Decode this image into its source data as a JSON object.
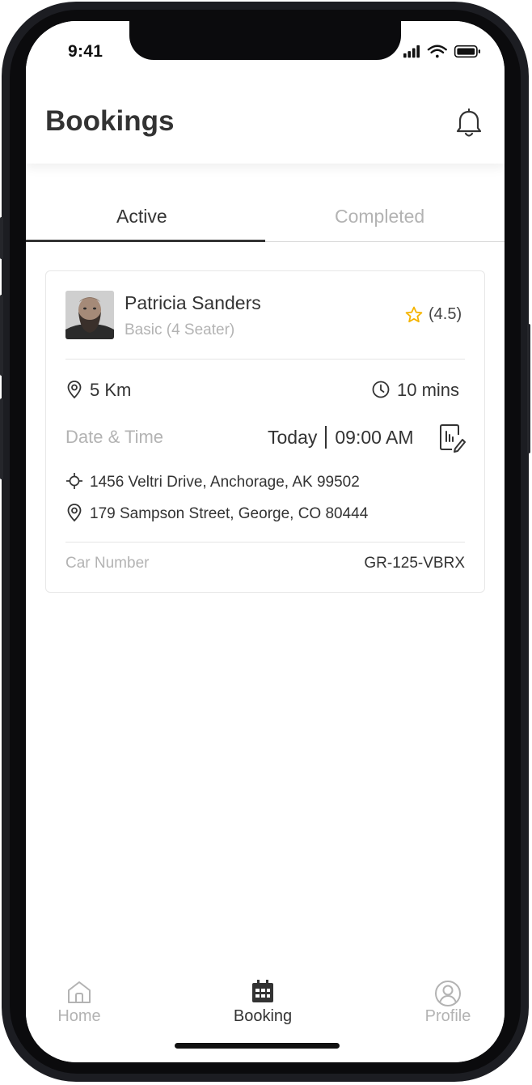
{
  "status_bar": {
    "time": "9:41"
  },
  "header": {
    "title": "Bookings"
  },
  "tabs": [
    {
      "label": "Active",
      "active": true
    },
    {
      "label": "Completed",
      "active": false
    }
  ],
  "booking": {
    "driver_name": "Patricia Sanders",
    "vehicle_type": "Basic (4 Seater)",
    "rating": "(4.5)",
    "distance": "5 Km",
    "duration": "10 mins",
    "date_time_label": "Date & Time",
    "date": "Today",
    "time": "09:00 AM",
    "pickup_address": "1456 Veltri Drive, Anchorage, AK 99502",
    "dropoff_address": "179 Sampson Street, George, CO 80444",
    "car_number_label": "Car Number",
    "car_number": "GR-125-VBRX"
  },
  "nav": [
    {
      "label": "Home",
      "icon": "home-icon",
      "active": false
    },
    {
      "label": "Booking",
      "icon": "calendar-icon",
      "active": true
    },
    {
      "label": "Profile",
      "icon": "profile-icon",
      "active": false
    }
  ],
  "colors": {
    "star": "#f5b400",
    "active_text": "#333333",
    "inactive_text": "#b3b3b3"
  }
}
